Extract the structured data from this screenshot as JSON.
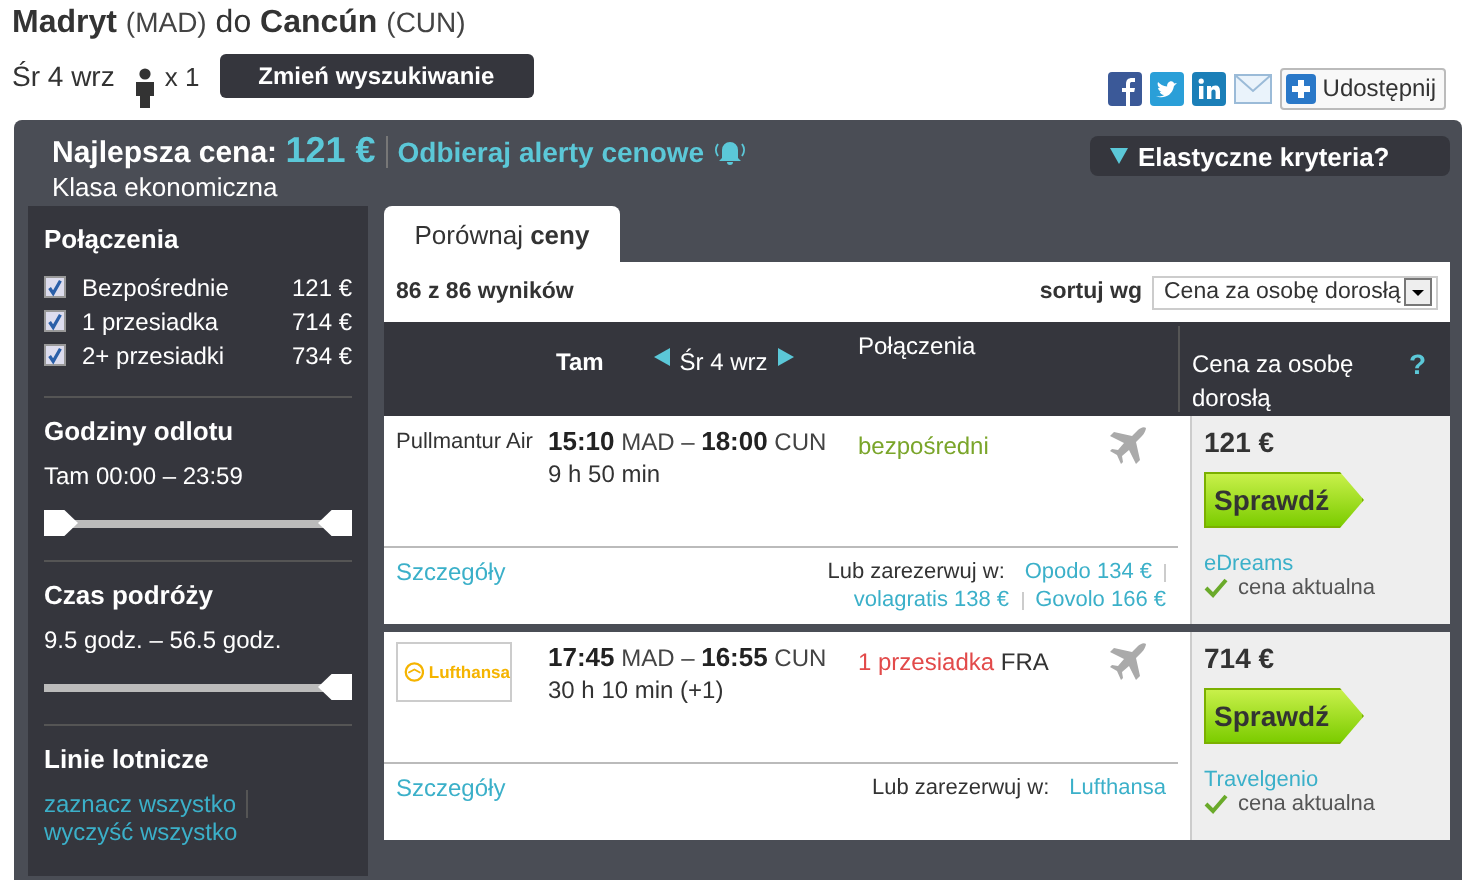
{
  "route": {
    "from_city": "Madryt",
    "from_code": "(MAD)",
    "connector": "do",
    "to_city": "Cancún",
    "to_code": "(CUN)"
  },
  "trip": {
    "date": "Śr 4 wrz",
    "passengers": "x 1",
    "change_button": "Zmień wyszukiwanie"
  },
  "share": {
    "button": "Udostępnij"
  },
  "summary": {
    "best_label": "Najlepsza cena:",
    "best_price": "121 €",
    "alerts_link": "Odbieraj alerty cenowe",
    "cabin": "Klasa ekonomiczna",
    "flexible": "Elastyczne kryteria?"
  },
  "filters": {
    "connections_title": "Połączenia",
    "connections": [
      {
        "label": "Bezpośrednie",
        "price": "121 €",
        "checked": true
      },
      {
        "label": "1 przesiadka",
        "price": "714 €",
        "checked": true
      },
      {
        "label": "2+ przesiadki",
        "price": "734 €",
        "checked": true
      }
    ],
    "sliders": [
      {
        "title": "Godziny odlotu",
        "reading": "Tam 00:00 – 23:59",
        "kind": "range",
        "level": 1
      },
      {
        "title": "Czas podróży",
        "reading": "9.5 godz. – 56.5 godz.",
        "kind": "single",
        "level": 1
      }
    ],
    "airlines_title": "Linie lotnicze",
    "select_all": "zaznacz wszystko",
    "clear_all": "wyczyść wszystko"
  },
  "tabs": [
    {
      "label_plain": "Porównaj",
      "label_bold": "ceny",
      "selected": true
    }
  ],
  "results": {
    "count": "86 z 86 wyników",
    "sort_label": "sortuj wg",
    "sort_value": "Cena za osobę dorosłą"
  },
  "table": {
    "col_out": "Tam",
    "date": "Śr 4 wrz",
    "col_connections": "Połączenia",
    "col_price": "Cena za osobę dorosłą",
    "help": "?"
  },
  "flights": [
    {
      "airline": {
        "kind": "text",
        "name": "Pullmantur Air"
      },
      "dep": "15:10",
      "dep_code": "MAD",
      "separator": "–",
      "arr": "18:00",
      "arr_code": "CUN",
      "duration": "9 h 50 min",
      "stops": {
        "kind": "direct",
        "text": "bezpośredni"
      },
      "details": "Szczegóły",
      "or_book": "Lub zarezerwuj w:",
      "alternatives": [
        "Opodo 134 €",
        "volagratis 138 €",
        "Govolo 166 €"
      ],
      "price": "121 €",
      "check": "Sprawdź",
      "seller": "eDreams",
      "status": "cena aktualna"
    },
    {
      "airline": {
        "kind": "logo",
        "name": "Lufthansa"
      },
      "dep": "17:45",
      "dep_code": "MAD",
      "separator": "–",
      "arr": "16:55",
      "arr_code": "CUN",
      "duration": "30 h 10 min (+1)",
      "stops": {
        "kind": "transfer",
        "text": "1 przesiadka",
        "city": "FRA"
      },
      "details": "Szczegóły",
      "or_book": "Lub zarezerwuj w:",
      "alternatives": [
        "Lufthansa"
      ],
      "price": "714 €",
      "check": "Sprawdź",
      "seller": "Travelgenio",
      "status": "cena aktualna"
    }
  ]
}
